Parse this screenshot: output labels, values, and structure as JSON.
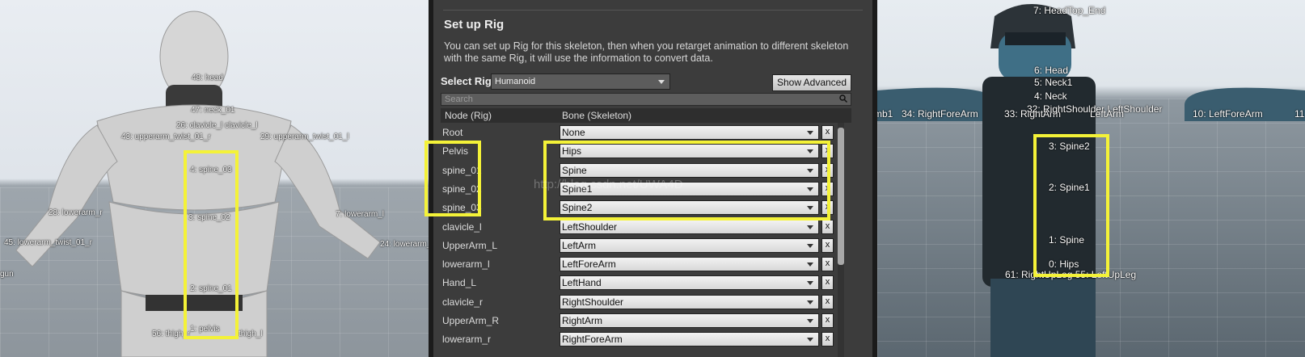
{
  "left_viewport": {
    "bone_labels": [
      {
        "name": "label-head",
        "text": "48: head"
      },
      {
        "name": "label-neck",
        "text": "47: neck_01"
      },
      {
        "name": "label-clavicle",
        "text": "26: clavicle_l clavicle_l"
      },
      {
        "name": "label-upperarm-r",
        "text": "43: upperarm_twist_01_r"
      },
      {
        "name": "label-upperarm-l",
        "text": "29: upperarm_twist_01_l"
      },
      {
        "name": "label-spine03",
        "text": "4: spine_03"
      },
      {
        "name": "label-lowerarm-r",
        "text": "28: lowerarm_r"
      },
      {
        "name": "label-lowerarm-l",
        "text": "7: lowerarm_l"
      },
      {
        "name": "label-spine02",
        "text": "3: spine_02"
      },
      {
        "name": "label-lowerarm-twist-r",
        "text": "45: lowerarm_twist_01_r"
      },
      {
        "name": "label-lowerarm-l-24",
        "text": "24: lowerarm_l"
      },
      {
        "name": "label-gun",
        "text": "gun"
      },
      {
        "name": "label-spine01",
        "text": "2: spine_01"
      },
      {
        "name": "label-thigh-r",
        "text": "56: thigh_r"
      },
      {
        "name": "label-pelvis",
        "text": "1: pelvis"
      },
      {
        "name": "label-thigh-l",
        "text": "thigh_l"
      }
    ]
  },
  "panel": {
    "title": "Set up Rig",
    "description": "You can set up Rig for this skeleton, then when you retarget animation to different skeleton with the same Rig, it will use the information to convert data.",
    "select_rig_label": "Select Rig",
    "select_rig_value": "Humanoid",
    "show_advanced_label": "Show Advanced",
    "search_placeholder": "Search",
    "columns": [
      "Node (Rig)",
      "Bone (Skeleton)"
    ],
    "rows": [
      {
        "node": "Root",
        "bone": "None"
      },
      {
        "node": "Pelvis",
        "bone": "Hips"
      },
      {
        "node": "spine_01",
        "bone": "Spine"
      },
      {
        "node": "spine_02",
        "bone": "Spine1"
      },
      {
        "node": "spine_03",
        "bone": "Spine2"
      },
      {
        "node": "clavicle_l",
        "bone": "LeftShoulder"
      },
      {
        "node": "UpperArm_L",
        "bone": "LeftArm"
      },
      {
        "node": "lowerarm_l",
        "bone": "LeftForeArm"
      },
      {
        "node": "Hand_L",
        "bone": "LeftHand"
      },
      {
        "node": "clavicle_r",
        "bone": "RightShoulder"
      },
      {
        "node": "UpperArm_R",
        "bone": "RightArm"
      },
      {
        "node": "lowerarm_r",
        "bone": "RightForeArm"
      }
    ],
    "clear_label": "x",
    "watermark": "http://blog.csdn.net/UWA4D"
  },
  "right_viewport": {
    "bone_labels": [
      {
        "name": "label-headtop",
        "text": "7: HeadTop_End"
      },
      {
        "name": "label-head-r",
        "text": "6: Head"
      },
      {
        "name": "label-neck1",
        "text": "5: Neck1"
      },
      {
        "name": "label-neck",
        "text": "4: Neck"
      },
      {
        "name": "label-thumb",
        "text": "mb1"
      },
      {
        "name": "label-rightforearm",
        "text": "34: RightForeArm"
      },
      {
        "name": "label-rightarm",
        "text": "33: RightArm"
      },
      {
        "name": "label-shoulders",
        "text": "32: RightShoulder LeftShoulder"
      },
      {
        "name": "label-leftarm",
        "text": "LeftArm"
      },
      {
        "name": "label-leftforearm",
        "text": "10: LeftForeArm"
      },
      {
        "name": "label-11",
        "text": "11"
      },
      {
        "name": "label-spine2",
        "text": "3: Spine2"
      },
      {
        "name": "label-spine1",
        "text": "2: Spine1"
      },
      {
        "name": "label-spine",
        "text": "1: Spine"
      },
      {
        "name": "label-hips",
        "text": "0: Hips"
      },
      {
        "name": "label-uplegs",
        "text": "61: RightUpLeg 55: LeftUpLeg"
      }
    ]
  },
  "colors": {
    "highlight": "#f4f238",
    "panel_bg": "#3c3c3c"
  }
}
